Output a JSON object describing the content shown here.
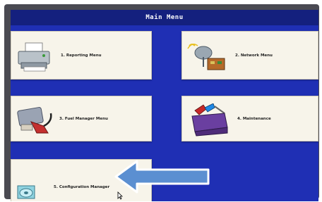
{
  "header": {
    "title": "Main Menu"
  },
  "menu": {
    "reporting": "1. Reporting Menu",
    "network": "2. Network Menu",
    "fuel_manager": "3. Fuel Manager Menu",
    "maintenance": "4. Maintenance",
    "configuration": "5. Configuration Manager"
  },
  "icons": {
    "reporting": "printer-icon",
    "network": "satellite-dish-icon",
    "fuel_manager": "fuel-nozzle-icon",
    "maintenance": "toolbox-icon",
    "configuration": "disc-icon",
    "annotation": "arrow-left-icon"
  },
  "colors": {
    "screen_blue": "#1f2fb4",
    "title_bar": "#14207e",
    "tile": "#f7f4ea",
    "arrow_fill": "#5b8fd1"
  }
}
